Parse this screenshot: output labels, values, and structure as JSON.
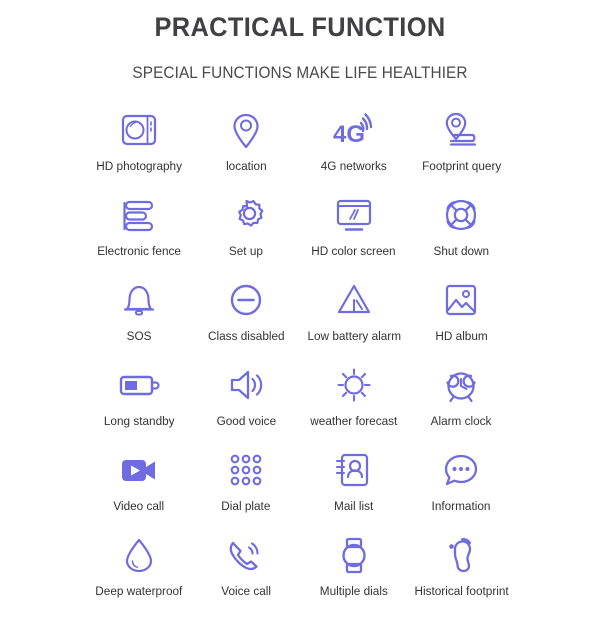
{
  "header": {
    "title": "PRACTICAL FUNCTION",
    "subtitle": "SPECIAL FUNCTIONS MAKE LIFE HEALTHIER"
  },
  "theme": {
    "accent": "#6f6ce0",
    "title_color": "#414042",
    "label_color": "#333333",
    "background": "#ffffff"
  },
  "features": [
    {
      "label": "HD photography",
      "icon": "camera-icon"
    },
    {
      "label": "location",
      "icon": "map-pin-icon"
    },
    {
      "label": "4G networks",
      "icon": "4g-signal-icon",
      "badge": "4G"
    },
    {
      "label": "Footprint query",
      "icon": "footprint-query-icon"
    },
    {
      "label": "Electronic fence",
      "icon": "stacked-bars-icon"
    },
    {
      "label": "Set up",
      "icon": "gear-icon"
    },
    {
      "label": "HD color screen",
      "icon": "monitor-icon"
    },
    {
      "label": "Shut down",
      "icon": "life-ring-icon"
    },
    {
      "label": "SOS",
      "icon": "bell-icon"
    },
    {
      "label": "Class disabled",
      "icon": "minus-circle-icon"
    },
    {
      "label": "Low battery alarm",
      "icon": "warning-triangle-icon"
    },
    {
      "label": "HD album",
      "icon": "photo-album-icon"
    },
    {
      "label": "Long standby",
      "icon": "battery-icon"
    },
    {
      "label": "Good voice",
      "icon": "speaker-icon"
    },
    {
      "label": "weather forecast",
      "icon": "sun-icon"
    },
    {
      "label": "Alarm clock",
      "icon": "alarm-clock-icon"
    },
    {
      "label": "Video call",
      "icon": "video-camera-icon"
    },
    {
      "label": "Dial plate",
      "icon": "dialpad-icon"
    },
    {
      "label": "Mail list",
      "icon": "contact-book-icon"
    },
    {
      "label": "Information",
      "icon": "chat-bubble-icon"
    },
    {
      "label": "Deep waterproof",
      "icon": "water-drop-icon"
    },
    {
      "label": "Voice call",
      "icon": "phone-call-icon"
    },
    {
      "label": "Multiple dials",
      "icon": "watch-icon"
    },
    {
      "label": "Historical footprint",
      "icon": "footprint-icon"
    }
  ]
}
